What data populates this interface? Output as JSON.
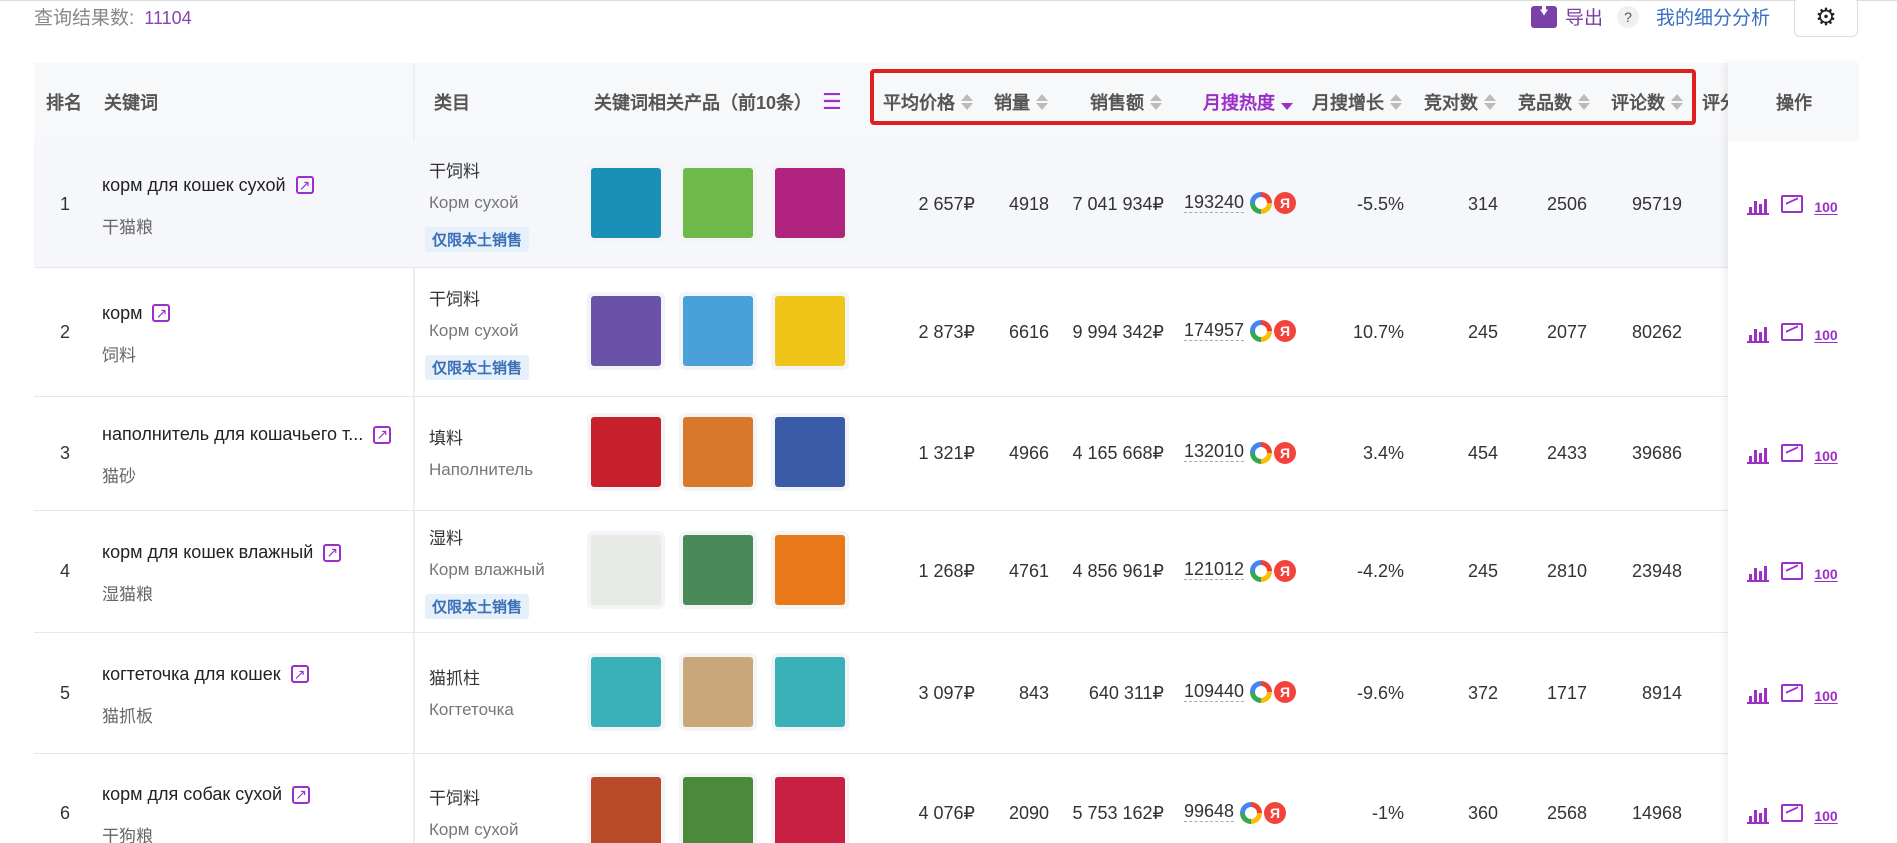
{
  "topbar": {
    "result_label": "查询结果数:",
    "result_count": "11104",
    "export_label": "导出",
    "help_label": "?",
    "analysis_link": "我的细分分析"
  },
  "headers": {
    "rank": "排名",
    "keyword": "关键词",
    "category": "类目",
    "products": "关键词相关产品（前10条）",
    "avg_price": "平均价格",
    "sales": "销量",
    "revenue": "销售额",
    "monthly_search": "月搜热度",
    "monthly_growth": "月搜增长",
    "competitors": "竞对数",
    "products_count": "竞品数",
    "reviews": "评论数",
    "rating_cut": "评分",
    "actions": "操作"
  },
  "rows": [
    {
      "rank": "1",
      "keyword": "корм для кошек сухой",
      "keyword_cn": "干猫粮",
      "cat_cn": "干饲料",
      "cat_ru": "Корм сухой",
      "tag": "仅限本土销售",
      "avg_price": "2 657₽",
      "sales": "4918",
      "revenue": "7 041 934₽",
      "search": "193240",
      "growth": "-5.5%",
      "competitors": "314",
      "products": "2506",
      "reviews": "95719",
      "thumbs": [
        "#1a8fb8",
        "#6fb84a",
        "#b0237f"
      ]
    },
    {
      "rank": "2",
      "keyword": "корм",
      "keyword_cn": "饲料",
      "cat_cn": "干饲料",
      "cat_ru": "Корм сухой",
      "tag": "仅限本土销售",
      "avg_price": "2 873₽",
      "sales": "6616",
      "revenue": "9 994 342₽",
      "search": "174957",
      "growth": "10.7%",
      "competitors": "245",
      "products": "2077",
      "reviews": "80262",
      "thumbs": [
        "#6a52a8",
        "#4aa0d8",
        "#f0c419"
      ]
    },
    {
      "rank": "3",
      "keyword": "наполнитель для кошачьего т...",
      "keyword_cn": "猫砂",
      "cat_cn": "填料",
      "cat_ru": "Наполнитель",
      "tag": "",
      "avg_price": "1 321₽",
      "sales": "4966",
      "revenue": "4 165 668₽",
      "search": "132010",
      "growth": "3.4%",
      "competitors": "454",
      "products": "2433",
      "reviews": "39686",
      "thumbs": [
        "#c8202a",
        "#d8782a",
        "#3a5ca8"
      ]
    },
    {
      "rank": "4",
      "keyword": "корм для кошек влажный",
      "keyword_cn": "湿猫粮",
      "cat_cn": "湿料",
      "cat_ru": "Корм влажный",
      "tag": "仅限本土销售",
      "avg_price": "1 268₽",
      "sales": "4761",
      "revenue": "4 856 961₽",
      "search": "121012",
      "growth": "-4.2%",
      "competitors": "245",
      "products": "2810",
      "reviews": "23948",
      "thumbs": [
        "#e8eae6",
        "#4a8a58",
        "#e8781a"
      ]
    },
    {
      "rank": "5",
      "keyword": "когтеточка для кошек",
      "keyword_cn": "猫抓板",
      "cat_cn": "猫抓柱",
      "cat_ru": "Когтеточка",
      "tag": "",
      "avg_price": "3 097₽",
      "sales": "843",
      "revenue": "640 311₽",
      "search": "109440",
      "growth": "-9.6%",
      "competitors": "372",
      "products": "1717",
      "reviews": "8914",
      "thumbs": [
        "#3ab0b8",
        "#c8a878",
        "#3ab0b8"
      ]
    },
    {
      "rank": "6",
      "keyword": "корм для собак сухой",
      "keyword_cn": "干狗粮",
      "cat_cn": "干饲料",
      "cat_ru": "Корм сухой",
      "tag": "",
      "avg_price": "4 076₽",
      "sales": "2090",
      "revenue": "5 753 162₽",
      "search": "99648",
      "growth": "-1%",
      "competitors": "360",
      "products": "2568",
      "reviews": "14968",
      "thumbs": [
        "#b84a2a",
        "#4a8a3a",
        "#c82040"
      ]
    }
  ],
  "icons": {
    "external": "external-link-icon",
    "google": "google-icon",
    "yandex": "yandex-icon",
    "yandex_letter": "Я"
  },
  "colors": {
    "accent": "#9b30c8",
    "highlight": "#e02020",
    "link": "#3a6fc4"
  }
}
